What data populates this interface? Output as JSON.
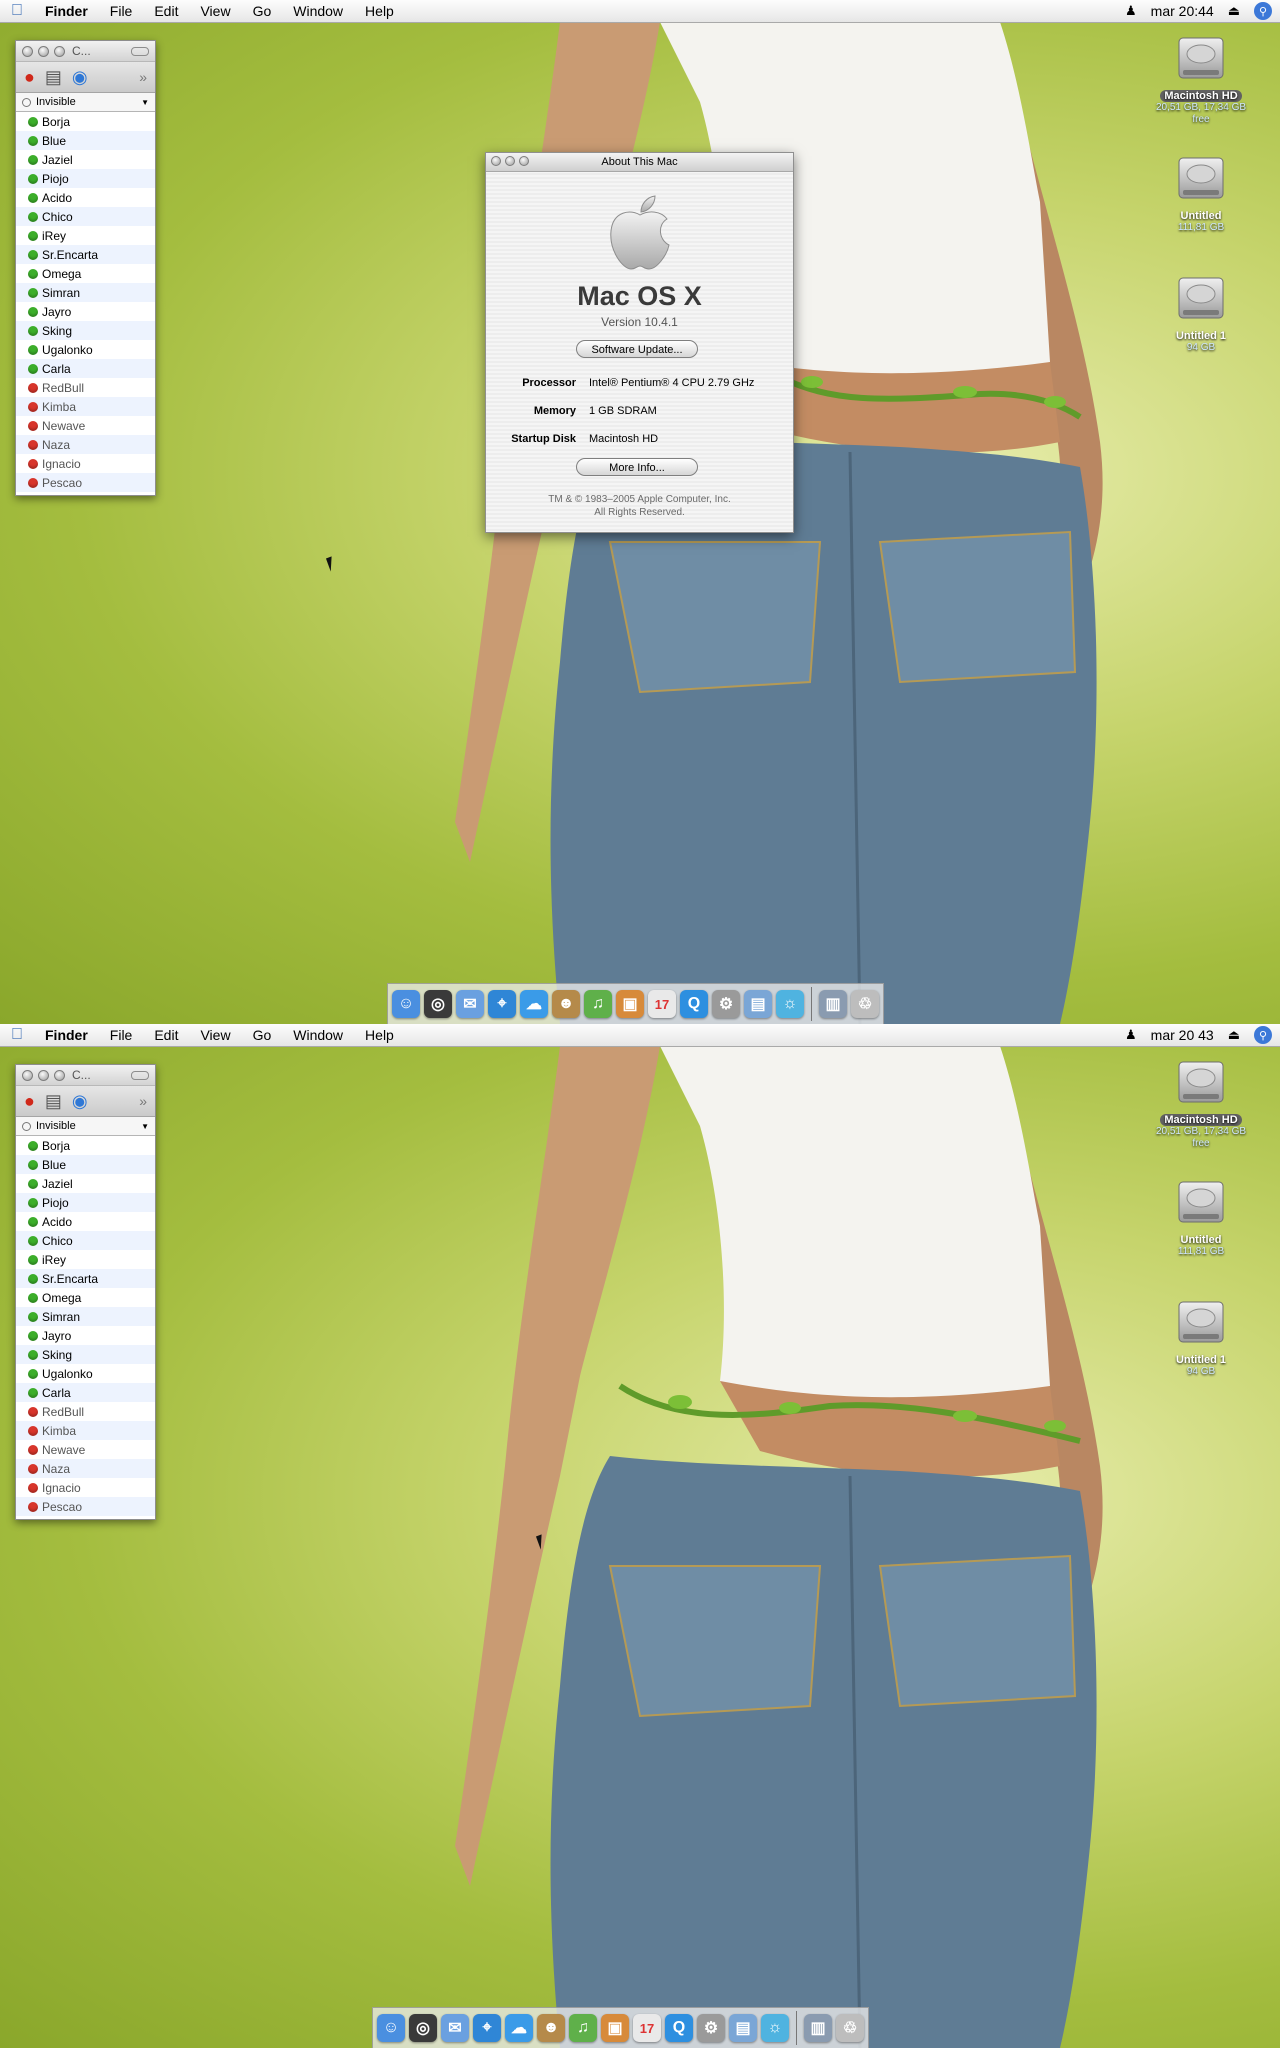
{
  "menubar": {
    "app": "Finder",
    "menus": [
      "File",
      "Edit",
      "View",
      "Go",
      "Window",
      "Help"
    ],
    "right_icons": [
      "screen-reader-icon",
      "eject-icon",
      "spotlight-icon"
    ]
  },
  "screens": [
    {
      "clock": "mar 20:44"
    },
    {
      "clock": "mar 20 43"
    }
  ],
  "buddy_window": {
    "title": "C...",
    "status": "Invisible",
    "buddies": [
      {
        "name": "Borja",
        "online": true
      },
      {
        "name": "Blue",
        "online": true
      },
      {
        "name": "Jaziel",
        "online": true
      },
      {
        "name": "Piojo",
        "online": true
      },
      {
        "name": "Acido",
        "online": true
      },
      {
        "name": "Chico",
        "online": true
      },
      {
        "name": "iRey",
        "online": true
      },
      {
        "name": "Sr.Encarta",
        "online": true
      },
      {
        "name": "Omega",
        "online": true
      },
      {
        "name": "Simran",
        "online": true
      },
      {
        "name": "Jayro",
        "online": true
      },
      {
        "name": "Sking",
        "online": true
      },
      {
        "name": "Ugalonko",
        "online": true
      },
      {
        "name": "Carla",
        "online": true
      },
      {
        "name": "RedBull",
        "online": false
      },
      {
        "name": "Kimba",
        "online": false
      },
      {
        "name": "Newave",
        "online": false
      },
      {
        "name": "Naza",
        "online": false
      },
      {
        "name": "Ignacio",
        "online": false
      },
      {
        "name": "Pescao",
        "online": false
      }
    ]
  },
  "about": {
    "window_title": "About This Mac",
    "os_name": "Mac OS X",
    "version": "Version 10.4.1",
    "software_update": "Software Update...",
    "specs": {
      "processor_label": "Processor",
      "processor": "Intel® Pentium® 4 CPU 2.79 GHz",
      "memory_label": "Memory",
      "memory": "1 GB SDRAM",
      "startup_label": "Startup Disk",
      "startup": "Macintosh HD"
    },
    "more_info": "More Info...",
    "copyright_1": "TM & © 1983–2005 Apple Computer, Inc.",
    "copyright_2": "All Rights Reserved."
  },
  "drives": [
    {
      "name": "Macintosh HD",
      "info": "20,51 GB, 17,34 GB free"
    },
    {
      "name": "Untitled",
      "info": "111,81 GB"
    },
    {
      "name": "Untitled 1",
      "info": "94 GB"
    }
  ],
  "dock": {
    "icons": [
      "finder-icon",
      "dashboard-icon",
      "mail-icon",
      "safari-icon",
      "ichat-icon",
      "address-book-icon",
      "itunes-icon",
      "iphoto-icon",
      "ical-icon",
      "quicktime-icon",
      "system-preferences-icon",
      "preview-icon",
      "messenger-icon",
      "document-icon",
      "trash-icon"
    ],
    "ical_date": "17"
  },
  "colors": {
    "wallpaper": "#a4bd3f",
    "online": "#3cae2a",
    "offline": "#d8352b",
    "selection_label": "#616161"
  }
}
